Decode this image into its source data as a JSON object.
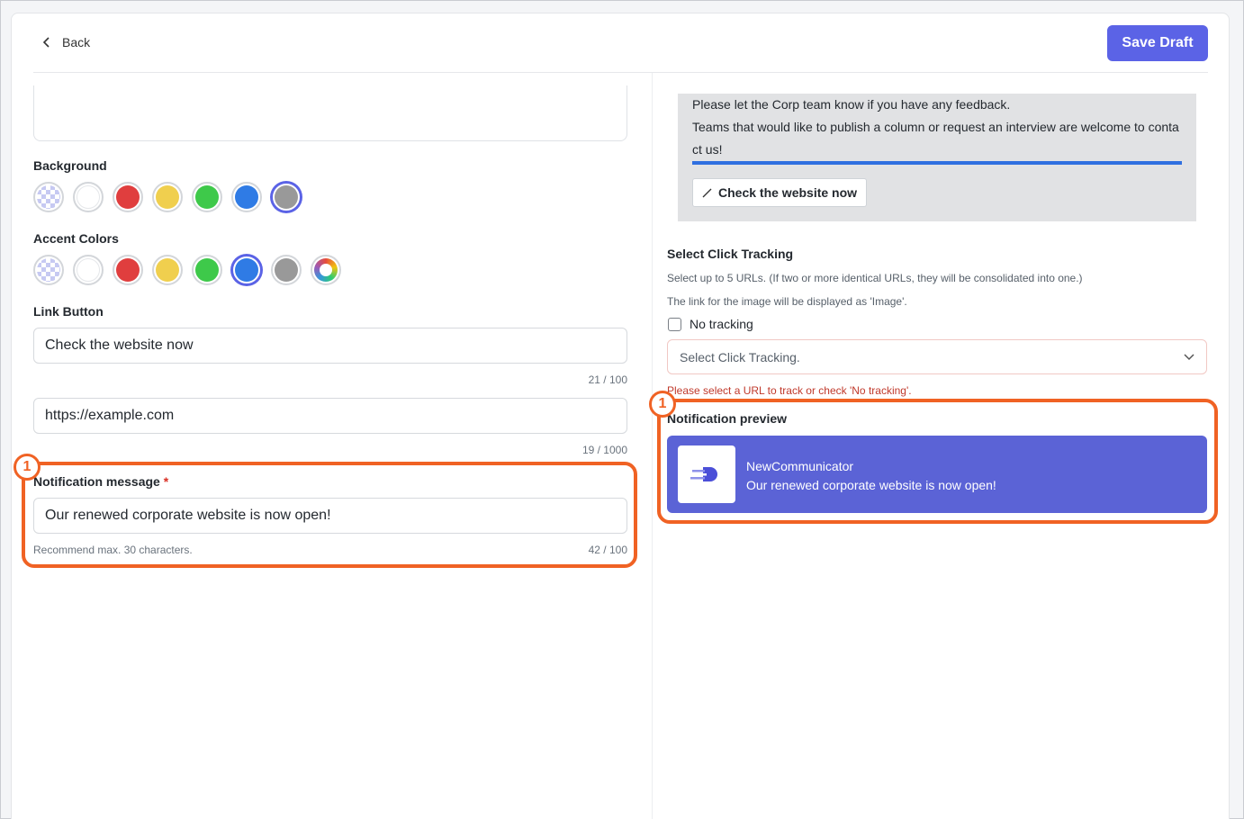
{
  "header": {
    "back_label": "Back",
    "save_label": "Save Draft"
  },
  "left": {
    "background_label": "Background",
    "background_colors": [
      "transparent",
      "#ffffff",
      "#e03e3e",
      "#f0cf4e",
      "#3ec94a",
      "#2f7be5",
      "#999999"
    ],
    "accent_label": "Accent Colors",
    "accent_colors": [
      "transparent",
      "#ffffff",
      "#e03e3e",
      "#f0cf4e",
      "#3ec94a",
      "#2f7be5",
      "#999999"
    ],
    "link_button_label": "Link Button",
    "link_text_value": "Check the website now",
    "link_text_count": "21 / 100",
    "link_url_value": "https://example.com",
    "link_url_count": "19 / 1000",
    "notif_label": "Notification message",
    "notif_required": "*",
    "notif_value": "Our renewed corporate website is now open!",
    "notif_hint": "Recommend max. 30 characters.",
    "notif_count": "42 / 100"
  },
  "right": {
    "preview_line1": "Please let the Corp team know if you have any feedback.",
    "preview_line2": "Teams that would like to publish a column or request an interview are welcome to conta",
    "preview_line3": "ct us!",
    "preview_button": "Check the website now",
    "tracking_label": "Select Click Tracking",
    "tracking_hint1": "Select up to 5 URLs. (If two or more identical URLs, they will be consolidated into one.)",
    "tracking_hint2": "The link for the image will be displayed as 'Image'.",
    "no_tracking": "No tracking",
    "select_placeholder": "Select Click Tracking.",
    "error_text": "Please select a URL to track or check 'No tracking'.",
    "notif_preview_label": "Notification preview",
    "notif_app": "NewCommunicator",
    "notif_message": "Our renewed corporate website is now open!"
  },
  "badges": {
    "left": "1",
    "right": "1"
  },
  "colors": {
    "accent": "#5b63e6",
    "highlight": "#f06224",
    "preview_bg": "#5b63d6"
  }
}
